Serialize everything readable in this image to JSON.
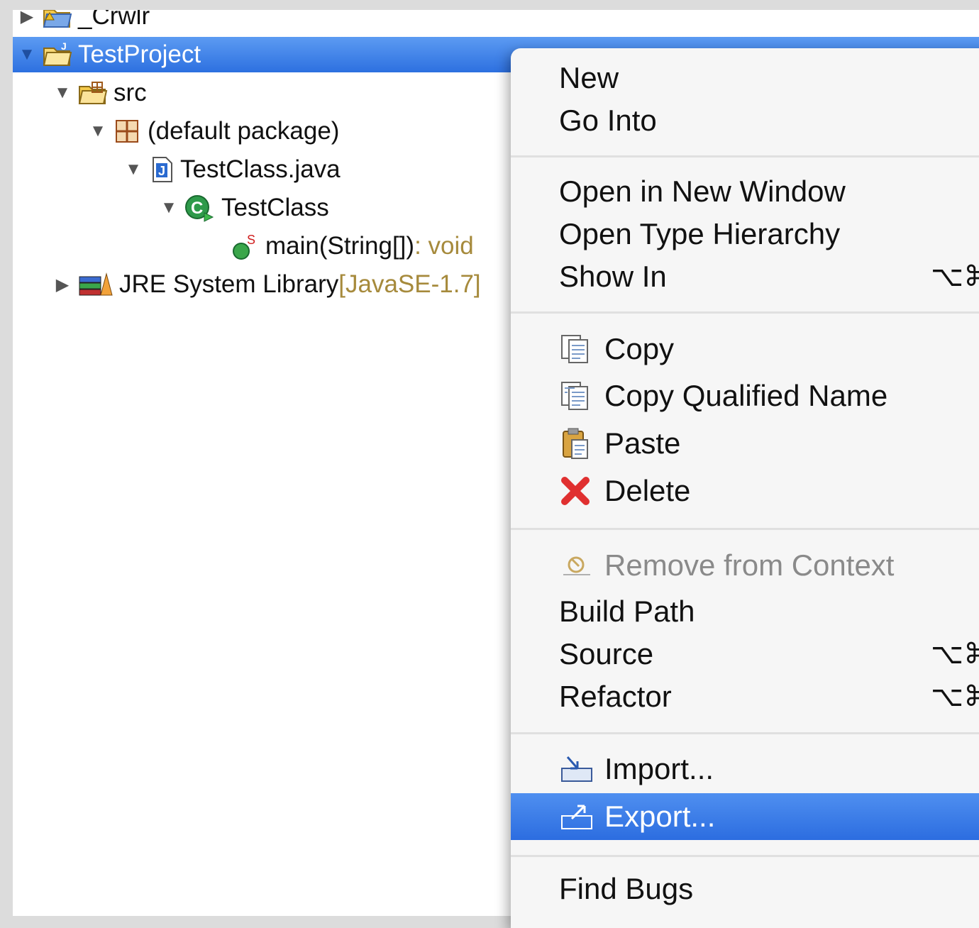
{
  "tree": {
    "items": [
      {
        "label": "_Crwlr",
        "expanded": false,
        "icon": "project-folder-warning-icon"
      },
      {
        "label": "TestProject",
        "expanded": true,
        "selected": true,
        "icon": "java-project-icon"
      },
      {
        "label": "src",
        "expanded": true,
        "icon": "source-folder-icon"
      },
      {
        "label": "(default package)",
        "expanded": true,
        "icon": "package-icon"
      },
      {
        "label": "TestClass.java",
        "expanded": true,
        "icon": "java-file-icon"
      },
      {
        "label": "TestClass",
        "expanded": true,
        "icon": "class-run-icon"
      },
      {
        "label": "main(String[])",
        "decoration": " : void",
        "icon": "static-method-icon"
      },
      {
        "label": "JRE System Library",
        "decoration": " [JavaSE-1.7]",
        "expanded": false,
        "icon": "library-icon"
      }
    ]
  },
  "context_menu": {
    "items": [
      {
        "label": "New"
      },
      {
        "label": "Go Into"
      },
      {
        "label": "Open in New Window"
      },
      {
        "label": "Open Type Hierarchy"
      },
      {
        "label": "Show In",
        "shortcut": "⌥⌘"
      },
      {
        "label": "Copy",
        "icon": "copy-icon"
      },
      {
        "label": "Copy Qualified Name",
        "icon": "copy-qualified-name-icon"
      },
      {
        "label": "Paste",
        "icon": "paste-icon"
      },
      {
        "label": "Delete",
        "icon": "delete-icon",
        "icon_color": "#e03030"
      },
      {
        "label": "Remove from Context",
        "icon": "remove-context-icon",
        "disabled": true
      },
      {
        "label": "Build Path"
      },
      {
        "label": "Source",
        "shortcut": "⌥⌘"
      },
      {
        "label": "Refactor",
        "shortcut": "⌥⌘"
      },
      {
        "label": "Import...",
        "icon": "import-icon"
      },
      {
        "label": "Export...",
        "icon": "export-icon",
        "highlighted": true
      },
      {
        "label": "Find Bugs"
      }
    ]
  },
  "colors": {
    "selection": "#3b7fe8",
    "decoration": "#a68a3c",
    "disabled": "#8a8a8a"
  }
}
